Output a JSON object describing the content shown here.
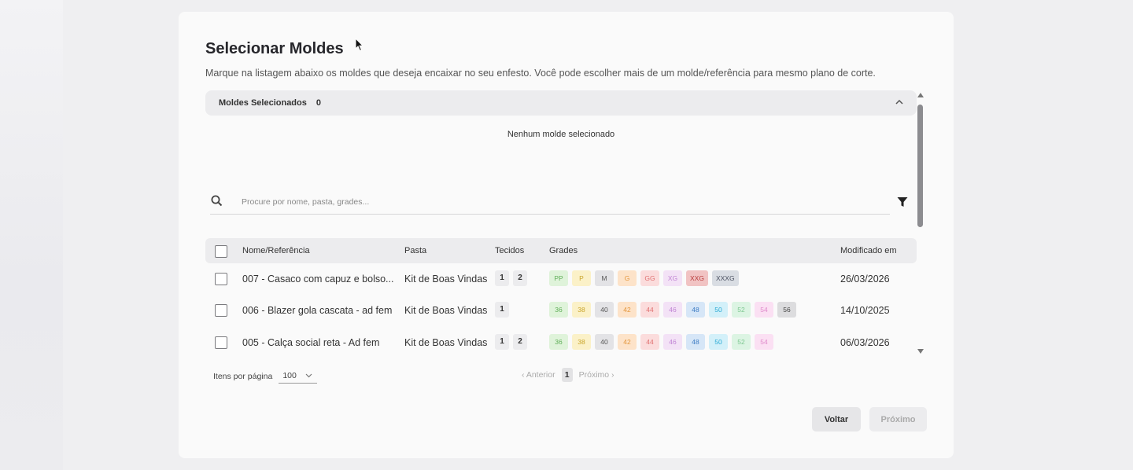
{
  "page": {
    "title": "Selecionar Moldes",
    "subtitle": "Marque na listagem abaixo os moldes que deseja encaixar no seu enfesto. Você pode escolher mais de um molde/referência para mesmo plano de corte."
  },
  "selected": {
    "label": "Moldes Selecionados",
    "count": "0",
    "empty_message": "Nenhum molde selecionado"
  },
  "search": {
    "placeholder": "Procure por nome, pasta, grades..."
  },
  "table": {
    "columns": {
      "name": "Nome/Referência",
      "folder": "Pasta",
      "fabrics": "Tecidos",
      "grades": "Grades",
      "modified": "Modificado em"
    },
    "rows": [
      {
        "name": "007 - Casaco com capuz e bolso...",
        "folder": "Kit de Boas Vindas",
        "fabrics": [
          "1",
          "2"
        ],
        "grades": [
          {
            "label": "PP",
            "bg": "#dff3da",
            "fg": "#5fae57"
          },
          {
            "label": "P",
            "bg": "#fbf1c8",
            "fg": "#c9a52b"
          },
          {
            "label": "M",
            "bg": "#e3e3e6",
            "fg": "#555"
          },
          {
            "label": "G",
            "bg": "#fde3c9",
            "fg": "#e4963c"
          },
          {
            "label": "GG",
            "bg": "#fbdcdc",
            "fg": "#e07272"
          },
          {
            "label": "XG",
            "bg": "#f3e2f6",
            "fg": "#c184d4"
          },
          {
            "label": "XXG",
            "bg": "#f1c3c3",
            "fg": "#b83b3b"
          },
          {
            "label": "XXXG",
            "bg": "#d9dde3",
            "fg": "#4a5060"
          }
        ],
        "date": "26/03/2026"
      },
      {
        "name": "006 - Blazer gola cascata - ad fem",
        "folder": "Kit de Boas Vindas",
        "fabrics": [
          "1"
        ],
        "grades": [
          {
            "label": "36",
            "bg": "#dff3da",
            "fg": "#5fae57"
          },
          {
            "label": "38",
            "bg": "#fbf1c8",
            "fg": "#c9a52b"
          },
          {
            "label": "40",
            "bg": "#e3e3e6",
            "fg": "#555"
          },
          {
            "label": "42",
            "bg": "#fde3c9",
            "fg": "#e4963c"
          },
          {
            "label": "44",
            "bg": "#fbdcdc",
            "fg": "#e07272"
          },
          {
            "label": "46",
            "bg": "#f3e2f6",
            "fg": "#c184d4"
          },
          {
            "label": "48",
            "bg": "#d6e6f7",
            "fg": "#3f7dc4"
          },
          {
            "label": "50",
            "bg": "#d3f0f9",
            "fg": "#2aa9d4"
          },
          {
            "label": "52",
            "bg": "#dcf4e3",
            "fg": "#7dc790"
          },
          {
            "label": "54",
            "bg": "#fbe0f3",
            "fg": "#e08acb"
          },
          {
            "label": "56",
            "bg": "#dcdcde",
            "fg": "#444"
          }
        ],
        "date": "14/10/2025"
      },
      {
        "name": "005 - Calça social reta - Ad fem",
        "folder": "Kit de Boas Vindas",
        "fabrics": [
          "1",
          "2"
        ],
        "grades": [
          {
            "label": "36",
            "bg": "#dff3da",
            "fg": "#5fae57"
          },
          {
            "label": "38",
            "bg": "#fbf1c8",
            "fg": "#c9a52b"
          },
          {
            "label": "40",
            "bg": "#e3e3e6",
            "fg": "#555"
          },
          {
            "label": "42",
            "bg": "#fde3c9",
            "fg": "#e4963c"
          },
          {
            "label": "44",
            "bg": "#fbdcdc",
            "fg": "#e07272"
          },
          {
            "label": "46",
            "bg": "#f3e2f6",
            "fg": "#c184d4"
          },
          {
            "label": "48",
            "bg": "#d6e6f7",
            "fg": "#3f7dc4"
          },
          {
            "label": "50",
            "bg": "#d3f0f9",
            "fg": "#2aa9d4"
          },
          {
            "label": "52",
            "bg": "#dcf4e3",
            "fg": "#7dc790"
          },
          {
            "label": "54",
            "bg": "#fbe0f3",
            "fg": "#e08acb"
          }
        ],
        "date": "06/03/2026"
      }
    ]
  },
  "pagination": {
    "items_per_page_label": "Itens por página",
    "items_per_page_value": "100",
    "previous": "‹ Anterior",
    "current_page": "1",
    "next": "Próximo ›"
  },
  "footer": {
    "back_label": "Voltar",
    "next_label": "Próximo"
  },
  "icons": {
    "search": "search-icon",
    "filter": "filter-icon",
    "collapse": "chevron-up-icon",
    "dropdown": "chevron-down-icon"
  }
}
